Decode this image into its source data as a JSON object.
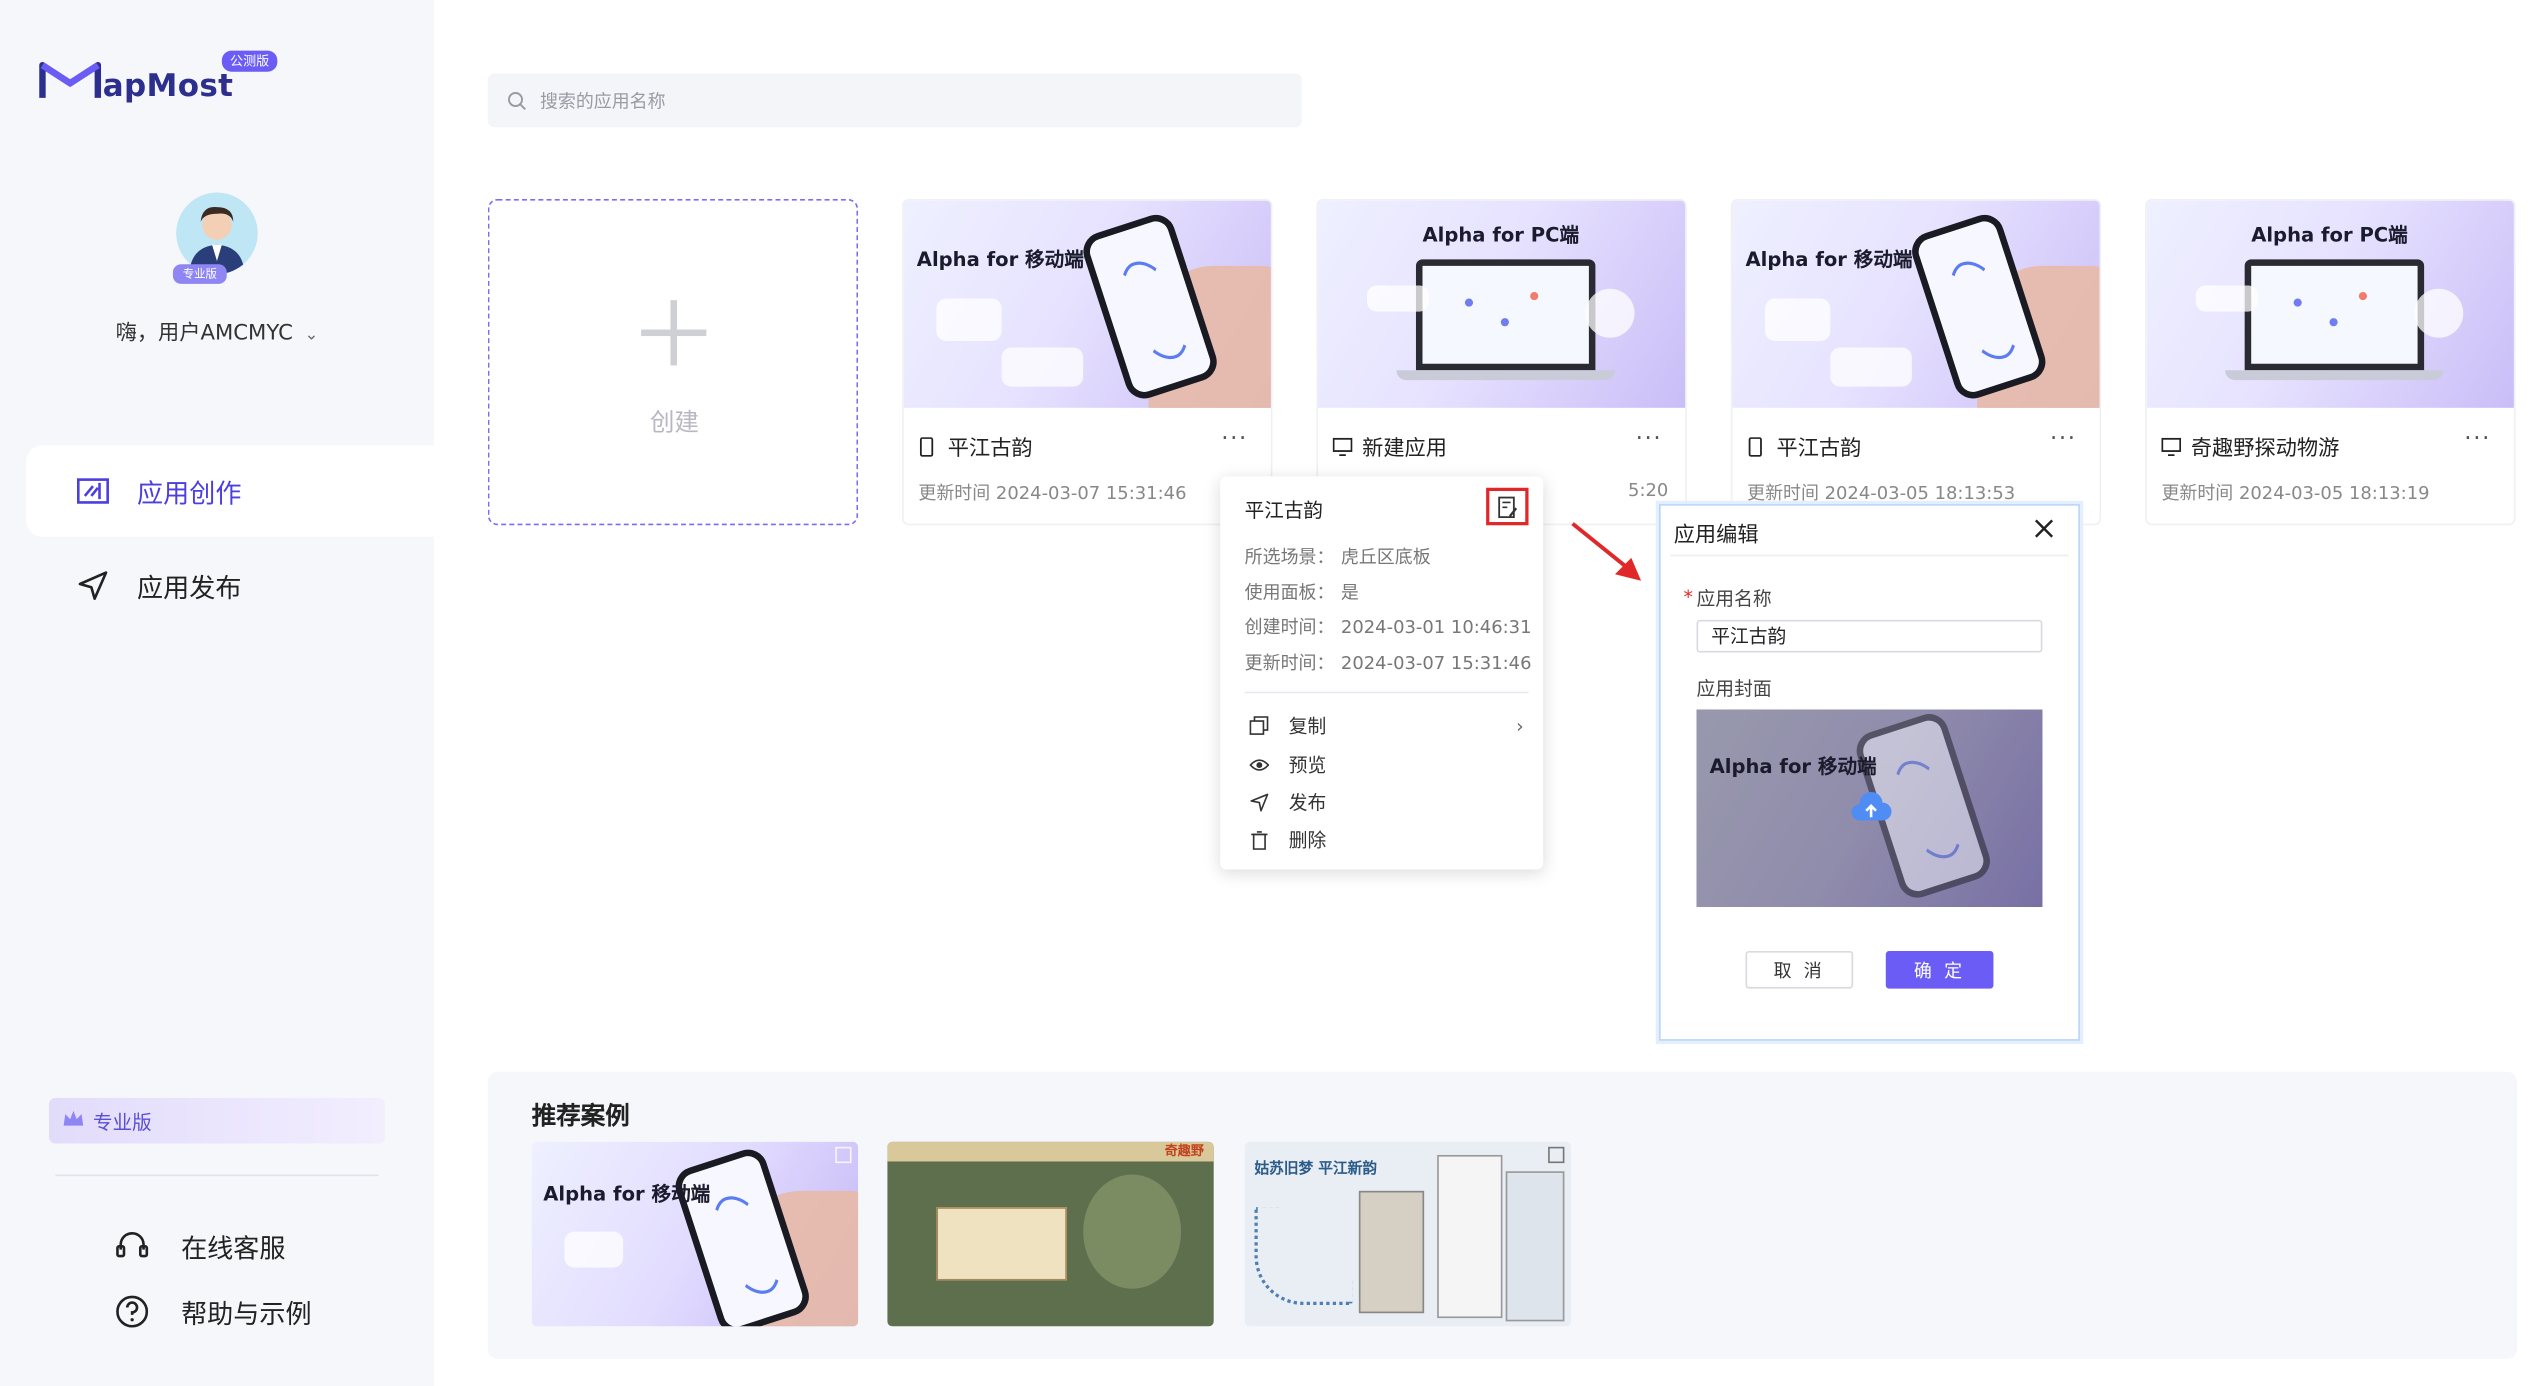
{
  "brand": {
    "logo_text": "apMost",
    "badge": "公测版"
  },
  "user": {
    "avatar_tag": "专业版",
    "greeting": "嗨，用户AMCMYC"
  },
  "nav": {
    "items": [
      {
        "label": "应用创作",
        "active": true
      },
      {
        "label": "应用发布",
        "active": false
      }
    ]
  },
  "sidebar_footer": {
    "plan_label": "专业版",
    "items": [
      {
        "label": "在线客服"
      },
      {
        "label": "帮助与示例"
      }
    ]
  },
  "search": {
    "placeholder": "搜索的应用名称"
  },
  "create_card": {
    "label": "创建"
  },
  "apps": [
    {
      "thumb_title": "Alpha for 移动端",
      "type_icon": "mobile-icon",
      "name": "平江古韵",
      "time": "更新时间 2024-03-07 15:31:46",
      "more": "···"
    },
    {
      "thumb_title": "Alpha for PC端",
      "type_icon": "desktop-icon",
      "name": "新建应用",
      "time": "5:20",
      "more": "···"
    },
    {
      "thumb_title": "Alpha for 移动端",
      "type_icon": "mobile-icon",
      "name": "平江古韵",
      "time": "更新时间 2024-03-05 18:13:53",
      "more": "···"
    },
    {
      "thumb_title": "Alpha for PC端",
      "type_icon": "desktop-icon",
      "name": "奇趣野探动物游",
      "time": "更新时间 2024-03-05 18:13:19",
      "more": "···"
    }
  ],
  "popover": {
    "title": "平江古韵",
    "rows": [
      {
        "key": "所选场景：",
        "value": "虎丘区底板"
      },
      {
        "key": "使用面板：",
        "value": "是"
      },
      {
        "key": "创建时间：",
        "value": "2024-03-01 10:46:31"
      },
      {
        "key": "更新时间：",
        "value": "2024-03-07 15:31:46"
      }
    ],
    "menu": [
      {
        "label": "复制",
        "icon": "copy-icon"
      },
      {
        "label": "预览",
        "icon": "eye-icon"
      },
      {
        "label": "发布",
        "icon": "send-icon"
      },
      {
        "label": "删除",
        "icon": "trash-icon"
      }
    ]
  },
  "modal": {
    "title": "应用编辑",
    "name_label": "应用名称",
    "name_required": "*",
    "name_value": "平江古韵",
    "cover_label": "应用封面",
    "cover_thumb_title": "Alpha for 移动端",
    "cancel_label": "取 消",
    "ok_label": "确 定"
  },
  "recommend": {
    "title": "推荐案例",
    "items": [
      {
        "thumb_title": "Alpha for 移动端"
      },
      {
        "thumb_title": "奇趣野"
      },
      {
        "thumb_title": "姑苏旧梦 平江新韵"
      }
    ]
  },
  "colors": {
    "accent": "#6b5cf6",
    "nav_active": "#4b3fe0",
    "highlight_red": "#e0282b"
  }
}
